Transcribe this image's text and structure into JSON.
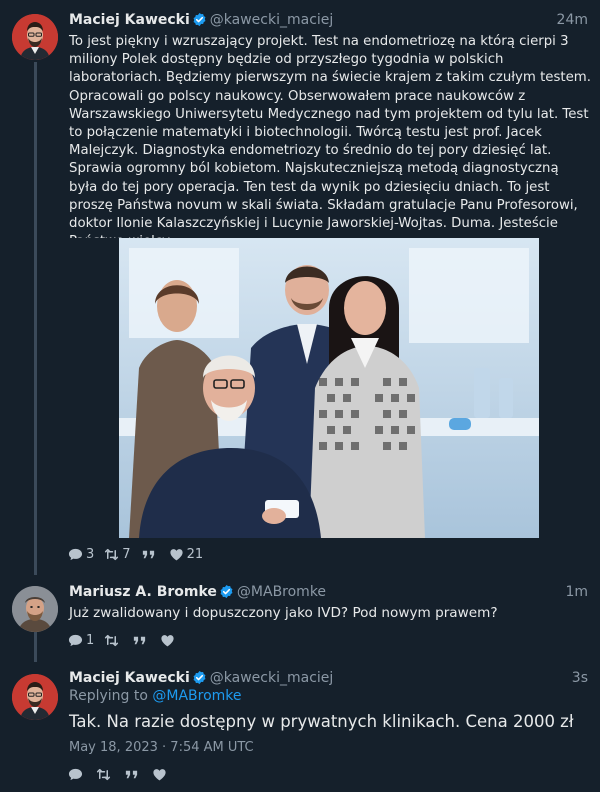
{
  "tweets": [
    {
      "name": "Maciej Kawecki",
      "handle": "@kawecki_maciej",
      "time": "24m",
      "text": "To jest piękny i wzruszający projekt. Test na endometriozę na którą cierpi 3 miliony Polek dostępny będzie od przyszłego tygodnia w polskich laboratoriach. Będziemy pierwszym na świecie krajem z takim czułym testem. Opracowali go polscy naukowcy. Obserwowałem prace naukowców z Warszawskiego Uniwersytetu Medycznego nad tym projektem od tylu lat. Test to połączenie matematyki i biotechnologii. Twórcą testu jest prof. Jacek Malejczyk. Diagnostyka endometriozy to średnio do tej pory dziesięć lat. Sprawia ogromny ból kobietom. Najskuteczniejszą metodą diagnostyczną była do tej pory operacja. Ten test da wynik po dziesięciu dniach. To jest proszę Państwa novum w skali świata. Składam gratulacje Panu Profesorowi, doktor Ilonie Kalaszczyńskiej i Lucynie Jaworskiej-Wojtas. Duma. Jesteście Państwo wielcy.",
      "replies": "3",
      "retweets": "7",
      "likes": "21"
    },
    {
      "name": "Mariusz A. Bromke",
      "handle": "@MABromke",
      "time": "1m",
      "text": "Już zwalidowany i dopuszczony jako IVD? Pod nowym prawem?",
      "replies": "1"
    },
    {
      "name": "Maciej Kawecki",
      "handle": "@kawecki_maciej",
      "time": "3s",
      "reply_prefix": "Replying to",
      "reply_to": "@MABromke",
      "text": "Tak. Na razie dostępny w prywatnych klinikach. Cena 2000 zł",
      "timestamp": "May 18, 2023 · 7:54 AM UTC"
    }
  ],
  "icons": {
    "reply": "reply-icon",
    "retweet": "retweet-icon",
    "quote": "quote-icon",
    "like": "heart-icon",
    "verified": "verified-badge-icon"
  },
  "colors": {
    "background": "#15202b",
    "accent": "#1d9bf0",
    "muted": "#8b98a5",
    "text": "#e7e9ea"
  }
}
